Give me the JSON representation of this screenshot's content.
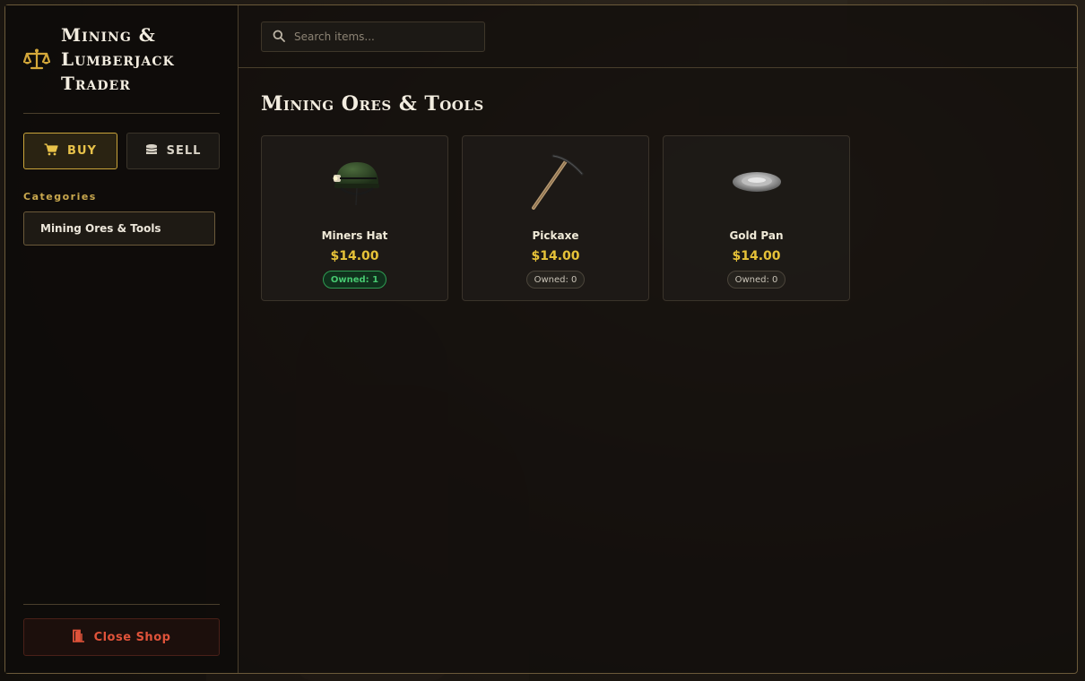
{
  "app": {
    "title": "Mining & Lumberjack Trader",
    "accent_color": "#e8c24a"
  },
  "sidebar": {
    "buy_label": "BUY",
    "sell_label": "SELL",
    "categories_heading": "Categories",
    "categories": [
      {
        "label": "Mining Ores & Tools",
        "selected": true
      }
    ],
    "close_label": "Close Shop"
  },
  "search": {
    "placeholder": "Search items..."
  },
  "main": {
    "section_title": "Mining Ores & Tools",
    "items": [
      {
        "name": "Miners Hat",
        "price": "$14.00",
        "owned": "Owned: 1",
        "icon": "miners-hat-icon"
      },
      {
        "name": "Pickaxe",
        "price": "$14.00",
        "owned": "Owned: 0",
        "icon": "pickaxe-icon"
      },
      {
        "name": "Gold Pan",
        "price": "$14.00",
        "owned": "Owned: 0",
        "icon": "gold-pan-icon"
      }
    ]
  }
}
